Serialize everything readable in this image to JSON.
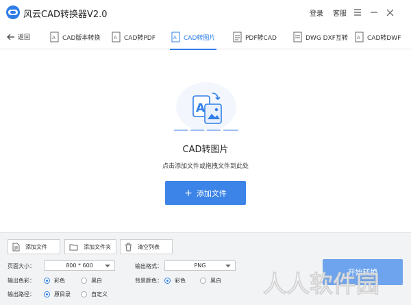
{
  "app": {
    "title": "风云CAD转换器V2.0",
    "login": "登录",
    "service": "客服"
  },
  "tabbar": {
    "back": "返回",
    "tabs": [
      {
        "label": "CAD版本转换"
      },
      {
        "label": "CAD转PDF"
      },
      {
        "label": "CAD转图片"
      },
      {
        "label": "PDF转CAD"
      },
      {
        "label": "DWG DXF互转"
      },
      {
        "label": "CAD转DWF"
      }
    ],
    "active_index": 2
  },
  "main": {
    "title": "CAD转图片",
    "subtitle": "点击添加文件或拖拽文件到此处",
    "add_button": "添加文件"
  },
  "bottom": {
    "add_file": "添加文件",
    "add_folder": "添加文件夹",
    "clear_list": "清空列表",
    "page_size": {
      "label": "页面大小：",
      "value": "800 * 600"
    },
    "output_format": {
      "label": "输出格式：",
      "value": "PNG"
    },
    "output_color": {
      "label": "输出色彩：",
      "options": [
        "彩色",
        "黑白"
      ],
      "selected": "彩色"
    },
    "bg_color": {
      "label": "背景颜色：",
      "options": [
        "彩色",
        "黑白"
      ],
      "selected": "彩色"
    },
    "output_path": {
      "label": "输出路径：",
      "options": [
        "原目录",
        "自定义"
      ],
      "selected": "原目录"
    },
    "start": "开始转换"
  },
  "watermark": "人人软件园",
  "colors": {
    "accent": "#2f7ee8",
    "button": "#3d84e8",
    "start_button": "#6ea4ee",
    "panel": "#f2f3f5"
  }
}
